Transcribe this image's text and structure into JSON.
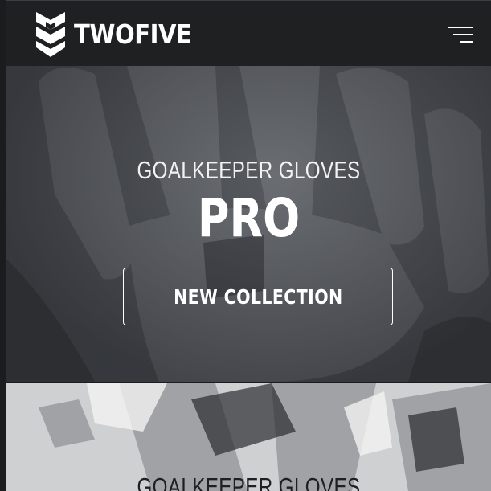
{
  "header": {
    "brand_name": "TWOFIVE",
    "logo_icon": "twofive-shield-logo",
    "menu_icon": "hamburger-menu-icon"
  },
  "hero": {
    "subtitle": "GOALKEEPER GLOVES",
    "title": "PRO",
    "cta_label": "NEW COLLECTION"
  },
  "hero2": {
    "subtitle": "GOALKEEPER GLOVES"
  },
  "colors": {
    "header_bg": "#1f2022",
    "text": "#ffffff"
  }
}
